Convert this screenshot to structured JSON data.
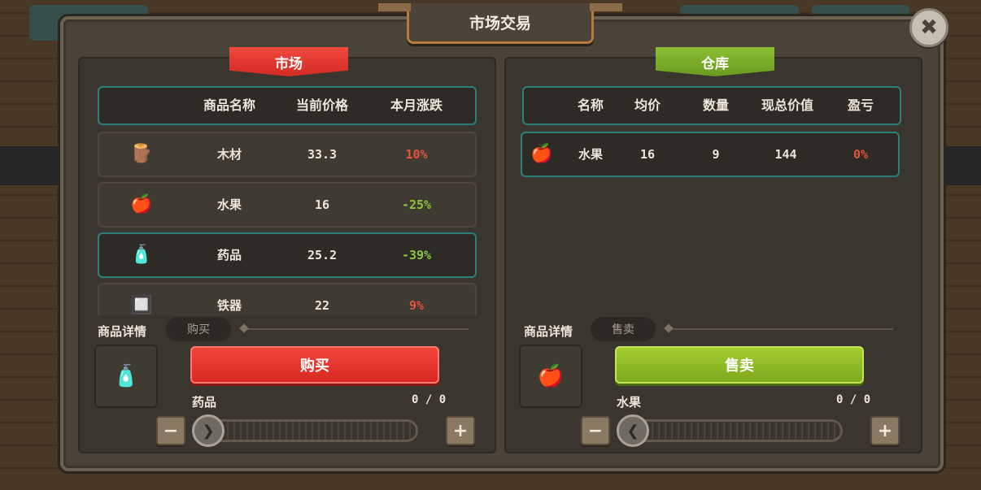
{
  "window": {
    "title": "市场交易",
    "close_label": "✖"
  },
  "market": {
    "ribbon": "市场",
    "headers": [
      "商品名称",
      "当前价格",
      "本月涨跌"
    ],
    "rows": [
      {
        "icon": "wood-icon",
        "glyph": "🪵",
        "name": "木材",
        "price": "33.3",
        "change": "10%",
        "trend": "up",
        "selected": false
      },
      {
        "icon": "apple-icon",
        "glyph": "🍎",
        "name": "水果",
        "price": "16",
        "change": "-25%",
        "trend": "down",
        "selected": false
      },
      {
        "icon": "medicine-icon",
        "glyph": "🧴",
        "name": "药品",
        "price": "25.2",
        "change": "-39%",
        "trend": "down",
        "selected": true
      },
      {
        "icon": "iron-icon",
        "glyph": "🔲",
        "name": "铁器",
        "price": "22",
        "change": "9%",
        "trend": "up",
        "selected": false
      }
    ],
    "detail_label": "商品详情",
    "mode_label": "购买",
    "action_label": "购买",
    "selected_name": "药品",
    "selected_count": "0 / 0",
    "selected_glyph": "🧴",
    "minus": "−",
    "plus": "+",
    "knob_glyph": "❯"
  },
  "warehouse": {
    "ribbon": "仓库",
    "headers": [
      "名称",
      "均价",
      "数量",
      "现总价值",
      "盈亏"
    ],
    "rows": [
      {
        "icon": "apple-icon",
        "glyph": "🍎",
        "name": "水果",
        "avg": "16",
        "qty": "9",
        "value": "144",
        "profit": "0%"
      }
    ],
    "detail_label": "商品详情",
    "mode_label": "售卖",
    "action_label": "售卖",
    "selected_name": "水果",
    "selected_count": "0 / 0",
    "selected_glyph": "🍎",
    "minus": "−",
    "plus": "+",
    "knob_glyph": "❮"
  },
  "colors": {
    "up": "#e4533e",
    "down": "#8cc43a",
    "accent_teal": "#2d8178",
    "buy_red": "#e5352b",
    "sell_green": "#8cbb26"
  }
}
